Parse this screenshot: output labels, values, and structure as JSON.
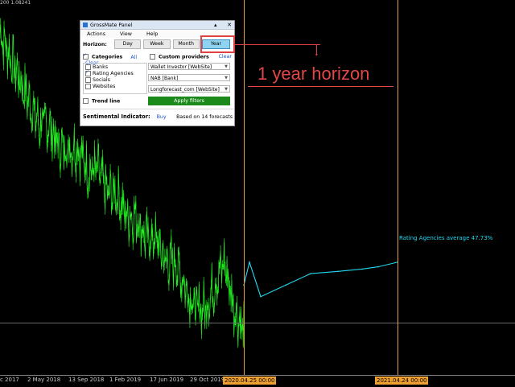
{
  "corner_readout": "200 1.08241",
  "panel": {
    "title": "GrossMate Panel",
    "title_buttons": [
      "▴",
      "✕"
    ],
    "menu": [
      "Actions",
      "View",
      "Help"
    ],
    "horizon_label": "Horizon:",
    "horizons": [
      "Day",
      "Week",
      "Month",
      "Year"
    ],
    "selected_horizon": "Year",
    "categories_label": "Categories",
    "categories_all": "All",
    "categories_clear": "Clear",
    "categories": [
      {
        "label": "Banks",
        "checked": false
      },
      {
        "label": "Rating Agencies",
        "checked": true
      },
      {
        "label": "Socials",
        "checked": false
      },
      {
        "label": "Websites",
        "checked": false
      }
    ],
    "custom_providers_label": "Custom providers",
    "custom_providers_clear": "Clear",
    "providers": [
      "Wallet Investor [WebSite]",
      "NAB [Bank]",
      "Longforecast_com [WebSite]"
    ],
    "trend_line_label": "Trend line",
    "apply_label": "Apply filters",
    "sentimental_label": "Sentimental Indicator:",
    "sentimental_value": "Buy",
    "based_on": "Based on 14 forecasts"
  },
  "annotation": {
    "text": "1 year horizon",
    "arrow_glyph": "↓"
  },
  "forecast_label": "Rating Agencies average 47.73%",
  "x_axis": {
    "ticks": [
      "c 2017",
      "2 May 2018",
      "13 Sep 2018",
      "1 Feb 2019",
      "17 Jun 2019",
      "29 Oct 2019"
    ],
    "markers": [
      "2020.04.25 00:00",
      "2021.04.24 00:00"
    ]
  },
  "colors": {
    "price": "#22ee22",
    "forecast": "#22d8f0",
    "annotation": "#e04040",
    "vertical_lines": "#e8a040",
    "apply_button": "#1b8a1b",
    "selected_tab": "#8fd3f0"
  },
  "chart_data": {
    "type": "line",
    "series": [
      {
        "values": [
          1.2,
          1.19,
          1.18,
          1.17,
          1.16,
          1.16,
          1.15,
          1.15,
          1.15,
          1.14,
          1.14,
          1.13,
          1.13,
          1.12,
          1.12,
          1.11,
          1.11,
          1.1,
          1.1,
          1.09,
          1.08,
          1.08,
          1.09,
          1.1,
          1.08,
          1.07
        ]
      },
      {
        "name": "Rating Agencies average 47.73%",
        "values": [
          1.09,
          1.1,
          1.085,
          1.09,
          1.095,
          1.096,
          1.097,
          1.098,
          1.1
        ]
      }
    ]
  }
}
